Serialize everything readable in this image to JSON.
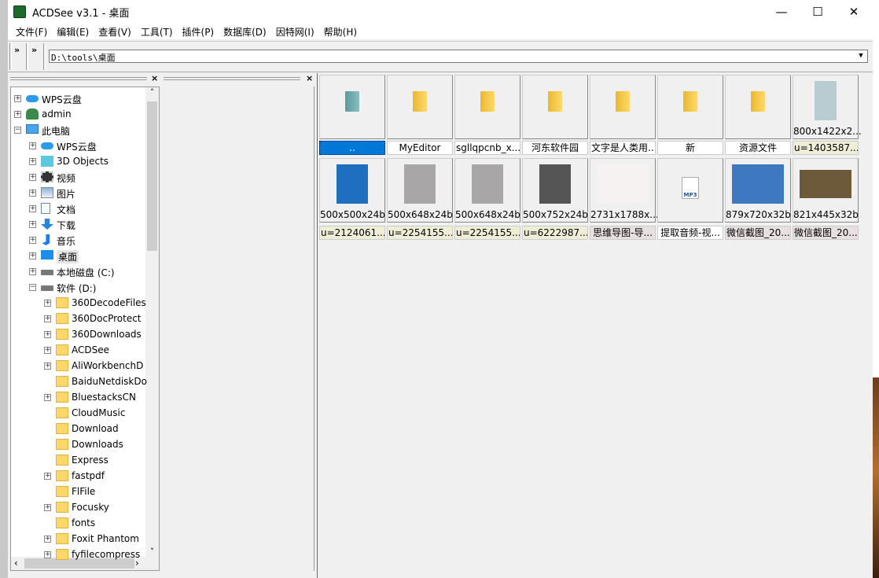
{
  "window": {
    "title": "ACDSee v3.1 - 桌面",
    "minimize": "—",
    "maximize": "☐",
    "close": "✕"
  },
  "menu": [
    "文件(F)",
    "编辑(E)",
    "查看(V)",
    "工具(T)",
    "插件(P)",
    "数据库(D)",
    "因特网(I)",
    "帮助(H)"
  ],
  "toolbar": {
    "chevron": "»",
    "address": "D:\\tools\\桌面",
    "dropdown": "▼"
  },
  "pane": {
    "close": "×"
  },
  "tree": [
    {
      "label": "WPS云盘",
      "level": 0,
      "exp": "+",
      "icon": "cloud-icon"
    },
    {
      "label": "admin",
      "level": 0,
      "exp": "+",
      "icon": "user-icon"
    },
    {
      "label": "此电脑",
      "level": 0,
      "exp": "-",
      "icon": "computer-icon"
    },
    {
      "label": "WPS云盘",
      "level": 1,
      "exp": "+",
      "icon": "cloud-icon"
    },
    {
      "label": "3D Objects",
      "level": 1,
      "exp": "+",
      "icon": "cube-icon"
    },
    {
      "label": "视频",
      "level": 1,
      "exp": "+",
      "icon": "video-icon"
    },
    {
      "label": "图片",
      "level": 1,
      "exp": "+",
      "icon": "picture-icon"
    },
    {
      "label": "文档",
      "level": 1,
      "exp": "+",
      "icon": "document-icon"
    },
    {
      "label": "下载",
      "level": 1,
      "exp": "+",
      "icon": "download-icon"
    },
    {
      "label": "音乐",
      "level": 1,
      "exp": "+",
      "icon": "music-icon"
    },
    {
      "label": "桌面",
      "level": 1,
      "exp": "+",
      "icon": "desktop-icon",
      "selected": true
    },
    {
      "label": "本地磁盘 (C:)",
      "level": 1,
      "exp": "+",
      "icon": "drive-icon"
    },
    {
      "label": "软件 (D:)",
      "level": 1,
      "exp": "-",
      "icon": "drive-icon"
    },
    {
      "label": "360DecodeFiles",
      "level": 2,
      "exp": "+",
      "icon": "folder-icon"
    },
    {
      "label": "360DocProtect",
      "level": 2,
      "exp": "+",
      "icon": "folder-icon"
    },
    {
      "label": "360Downloads",
      "level": 2,
      "exp": "+",
      "icon": "folder-icon"
    },
    {
      "label": "ACDSee",
      "level": 2,
      "exp": "+",
      "icon": "folder-icon"
    },
    {
      "label": "AliWorkbenchD",
      "level": 2,
      "exp": "+",
      "icon": "folder-icon"
    },
    {
      "label": "BaiduNetdiskDo",
      "level": 2,
      "exp": "",
      "icon": "folder-icon"
    },
    {
      "label": "BluestacksCN",
      "level": 2,
      "exp": "+",
      "icon": "folder-icon"
    },
    {
      "label": "CloudMusic",
      "level": 2,
      "exp": "",
      "icon": "folder-icon"
    },
    {
      "label": "Download",
      "level": 2,
      "exp": "",
      "icon": "folder-icon"
    },
    {
      "label": "Downloads",
      "level": 2,
      "exp": "",
      "icon": "folder-icon"
    },
    {
      "label": "Express",
      "level": 2,
      "exp": "",
      "icon": "folder-icon"
    },
    {
      "label": "fastpdf",
      "level": 2,
      "exp": "+",
      "icon": "folder-icon"
    },
    {
      "label": "FlFile",
      "level": 2,
      "exp": "",
      "icon": "folder-icon"
    },
    {
      "label": "Focusky",
      "level": 2,
      "exp": "+",
      "icon": "folder-icon"
    },
    {
      "label": "fonts",
      "level": 2,
      "exp": "",
      "icon": "folder-icon"
    },
    {
      "label": "Foxit Phantom",
      "level": 2,
      "exp": "+",
      "icon": "folder-icon"
    },
    {
      "label": "fyfilecompress",
      "level": 2,
      "exp": "+",
      "icon": "folder-icon"
    }
  ],
  "scroll": {
    "up": "˄",
    "down": "˅",
    "left": "‹",
    "right": "›"
  },
  "files": [
    {
      "name": "..",
      "type": "parent",
      "dims": "",
      "bg": "#0078d7",
      "selected": true
    },
    {
      "name": "MyEditor",
      "type": "folder",
      "dims": "",
      "bg": "#ffffff"
    },
    {
      "name": "sgllqpcnb_x...",
      "type": "folder",
      "dims": "",
      "bg": "#ffffff"
    },
    {
      "name": "河东软件园",
      "type": "folder",
      "dims": "",
      "bg": "#ffffff"
    },
    {
      "name": "文字是人类用...",
      "type": "folder",
      "dims": "",
      "bg": "#ffffff"
    },
    {
      "name": "新",
      "type": "folder",
      "dims": "",
      "bg": "#ffffff"
    },
    {
      "name": "资源文件",
      "type": "folder",
      "dims": "",
      "bg": "#ffffff"
    },
    {
      "name": "u=1403587...",
      "type": "image",
      "dims": "800x1422x2...",
      "bg": "#efedd6",
      "thumb": "#b8ccd2"
    },
    {
      "name": "u=2124061...",
      "type": "image",
      "dims": "500x500x24b",
      "bg": "#efedd6",
      "thumb": "#1f6fc0"
    },
    {
      "name": "u=2254155...",
      "type": "image",
      "dims": "500x648x24b",
      "bg": "#efedd6",
      "thumb": "#a9a6a8"
    },
    {
      "name": "u=2254155...",
      "type": "image",
      "dims": "500x648x24b",
      "bg": "#efedd6",
      "thumb": "#a9a6a8"
    },
    {
      "name": "u=6222987...",
      "type": "image",
      "dims": "500x752x24b",
      "bg": "#efedd6",
      "thumb": "#555555"
    },
    {
      "name": "思维导图-导...",
      "type": "image",
      "dims": "2731x1788x...",
      "bg": "#e8dfe0",
      "thumb": "#f6f2f2"
    },
    {
      "name": "提取音频-视...",
      "type": "mp3",
      "dims": "",
      "bg": "#ffffff",
      "icon_text": "MP3"
    },
    {
      "name": "微信截图_20...",
      "type": "image",
      "dims": "879x720x32b",
      "bg": "#e8dfe0",
      "thumb": "#3d78c0"
    },
    {
      "name": "微信截图_20...",
      "type": "image",
      "dims": "821x445x32b",
      "bg": "#e8dfe0",
      "thumb": "#6d5a3a"
    }
  ]
}
